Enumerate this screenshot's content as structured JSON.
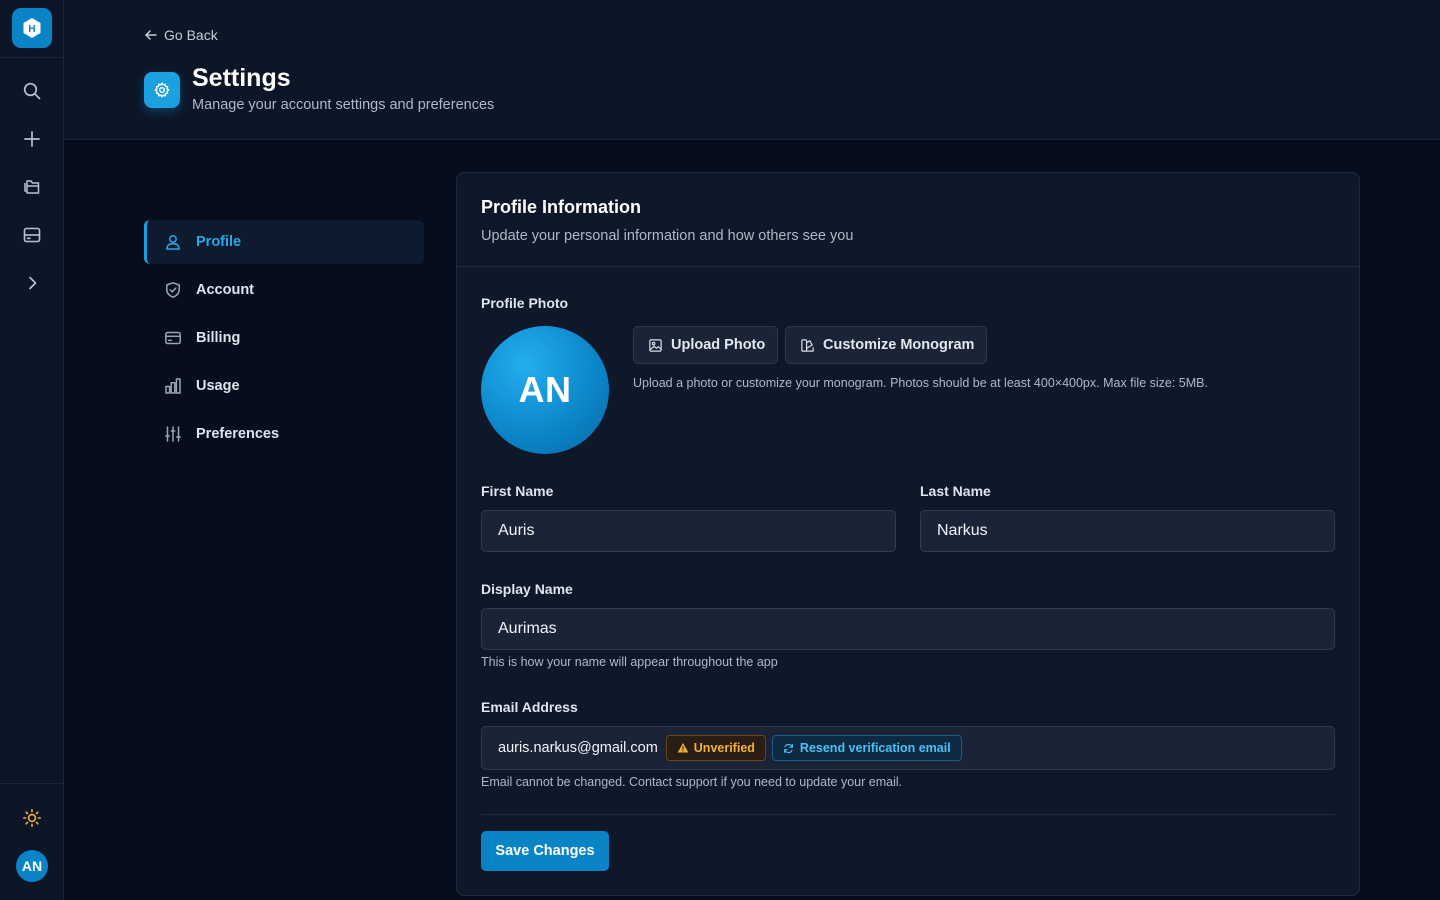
{
  "rail": {
    "logo_letter": "H",
    "icons": [
      "search-icon",
      "plus-icon",
      "folders-icon",
      "storage-icon",
      "chevron-right-icon"
    ],
    "theme_icon": "sun-icon",
    "avatar_initials": "AN"
  },
  "header": {
    "back_label": "Go Back",
    "title": "Settings",
    "subtitle": "Manage your account settings and preferences"
  },
  "nav": {
    "items": [
      {
        "label": "Profile",
        "icon": "user-icon",
        "active": true
      },
      {
        "label": "Account",
        "icon": "shield-icon",
        "active": false
      },
      {
        "label": "Billing",
        "icon": "credit-card-icon",
        "active": false
      },
      {
        "label": "Usage",
        "icon": "bar-chart-icon",
        "active": false
      },
      {
        "label": "Preferences",
        "icon": "sliders-icon",
        "active": false
      }
    ]
  },
  "profile": {
    "title": "Profile Information",
    "subtitle": "Update your personal information and how others see you",
    "photo_label": "Profile Photo",
    "avatar_initials": "AN",
    "upload_button": "Upload Photo",
    "monogram_button": "Customize Monogram",
    "photo_hint": "Upload a photo or customize your monogram. Photos should be at least 400×400px. Max file size: 5MB.",
    "first_name_label": "First Name",
    "first_name_value": "Auris",
    "last_name_label": "Last Name",
    "last_name_value": "Narkus",
    "display_name_label": "Display Name",
    "display_name_value": "Aurimas",
    "display_name_hint": "This is how your name will appear throughout the app",
    "email_label": "Email Address",
    "email_value": "auris.narkus@gmail.com",
    "email_status": "Unverified",
    "resend_label": "Resend verification email",
    "email_hint": "Email cannot be changed. Contact support if you need to update your email.",
    "save_button": "Save Changes"
  },
  "colors": {
    "accent": "#0b84c7",
    "background": "#060d1c",
    "panel": "#0f1829",
    "warning": "#f2b233"
  }
}
